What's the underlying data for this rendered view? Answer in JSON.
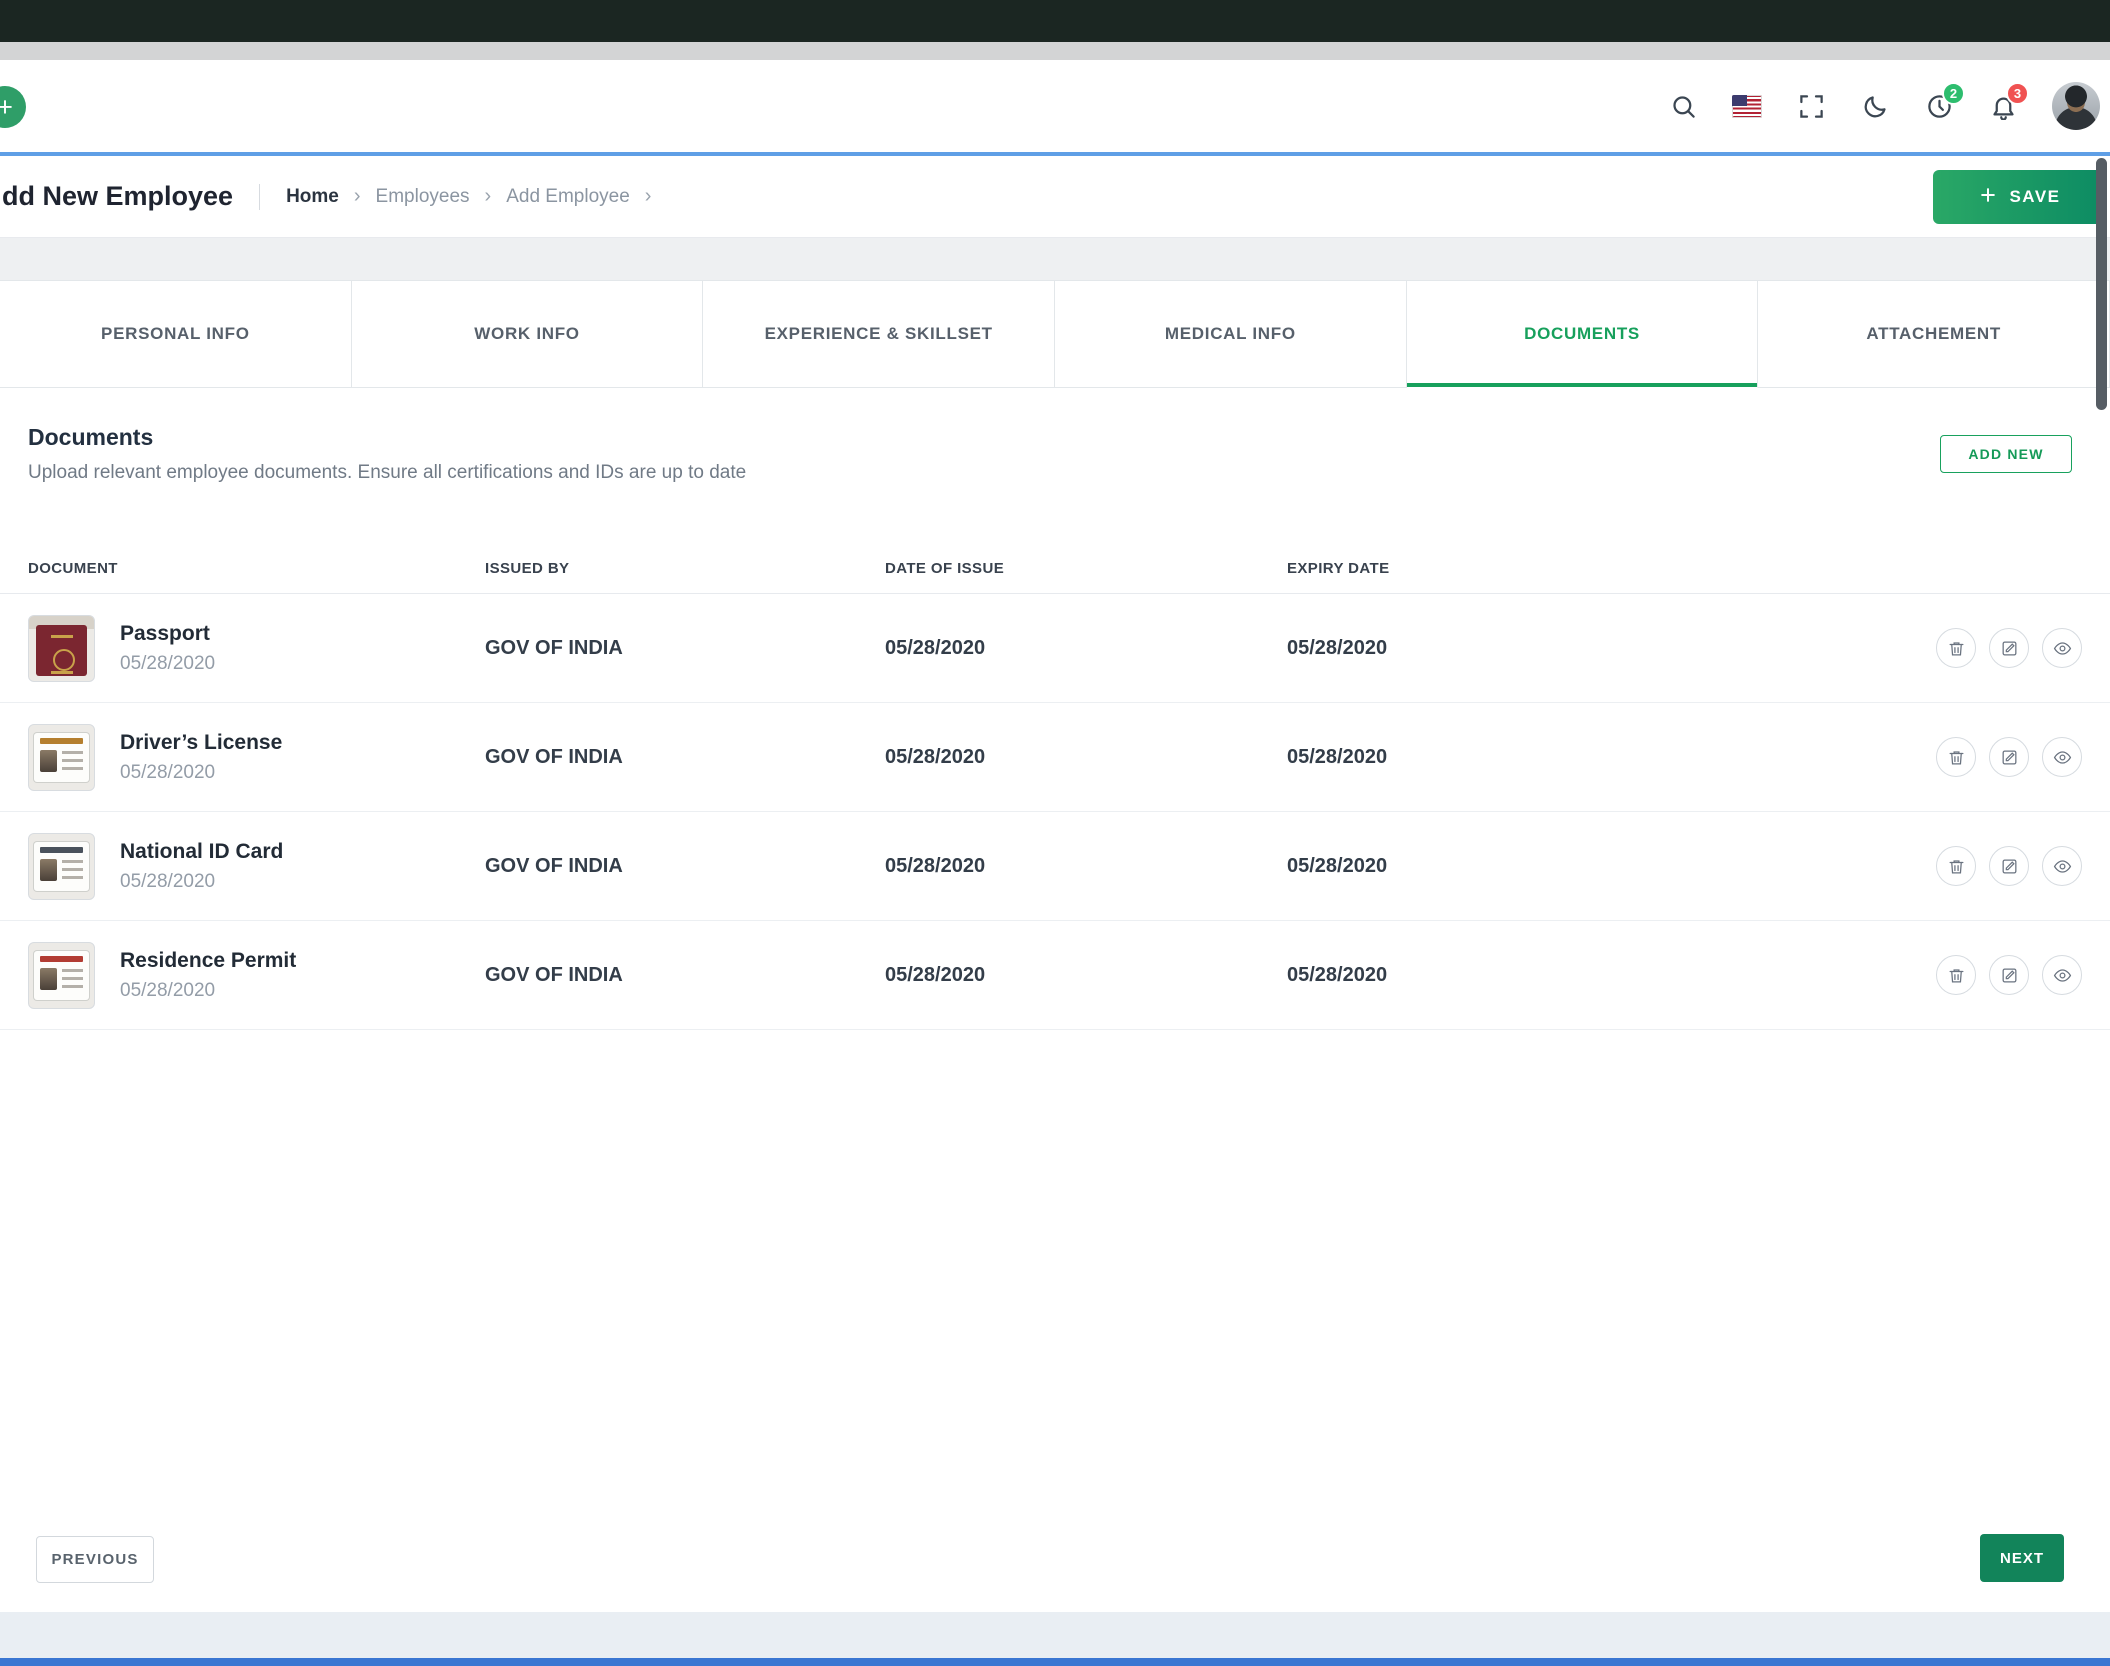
{
  "colors": {
    "accent_green": "#17a05c",
    "save_gradient_start": "#2aa866",
    "save_gradient_end": "#0c8b63",
    "highlight_blue": "#5f9fe6",
    "badge_green": "#2dbd6e",
    "badge_red": "#f05252"
  },
  "header": {
    "plus_button_label": "+",
    "clock_badge": "2",
    "bell_badge": "3",
    "icons": [
      "search-icon",
      "us-flag-icon",
      "fullscreen-icon",
      "moon-icon",
      "clock-icon",
      "bell-icon",
      "avatar"
    ]
  },
  "page": {
    "title": "dd New Employee",
    "breadcrumb": {
      "home": "Home",
      "employees": "Employees",
      "add_employee": "Add Employee",
      "separator": "›"
    },
    "save_label": "SAVE"
  },
  "tabs": [
    {
      "label": "PERSONAL INFO",
      "active": false
    },
    {
      "label": "WORK INFO",
      "active": false
    },
    {
      "label": "EXPERIENCE & SKILLSET",
      "active": false
    },
    {
      "label": "MEDICAL INFO",
      "active": false
    },
    {
      "label": "DOCUMENTS",
      "active": true
    },
    {
      "label": "ATTACHEMENT",
      "active": false
    }
  ],
  "documents": {
    "heading": "Documents",
    "subheading": "Upload relevant employee documents. Ensure all certifications and IDs are up to date",
    "add_new_label": "ADD NEW",
    "table": {
      "headers": [
        "DOCUMENT",
        "ISSUED BY",
        "DATE OF ISSUE",
        "EXPIRY DATE"
      ],
      "row_actions": [
        "delete-icon",
        "edit-icon",
        "view-icon"
      ],
      "rows": [
        {
          "name": "Passport",
          "date": "05/28/2020",
          "issued_by": "GOV OF INDIA",
          "date_of_issue": "05/28/2020",
          "expiry_date": "05/28/2020"
        },
        {
          "name": "Driver’s License",
          "date": "05/28/2020",
          "issued_by": "GOV OF INDIA",
          "date_of_issue": "05/28/2020",
          "expiry_date": "05/28/2020"
        },
        {
          "name": "National ID Card",
          "date": "05/28/2020",
          "issued_by": "GOV OF INDIA",
          "date_of_issue": "05/28/2020",
          "expiry_date": "05/28/2020"
        },
        {
          "name": "Residence Permit",
          "date": "05/28/2020",
          "issued_by": "GOV OF INDIA",
          "date_of_issue": "05/28/2020",
          "expiry_date": "05/28/2020"
        }
      ]
    }
  },
  "footer": {
    "previous_label": "PREVIOUS",
    "next_label": "NEXT"
  }
}
